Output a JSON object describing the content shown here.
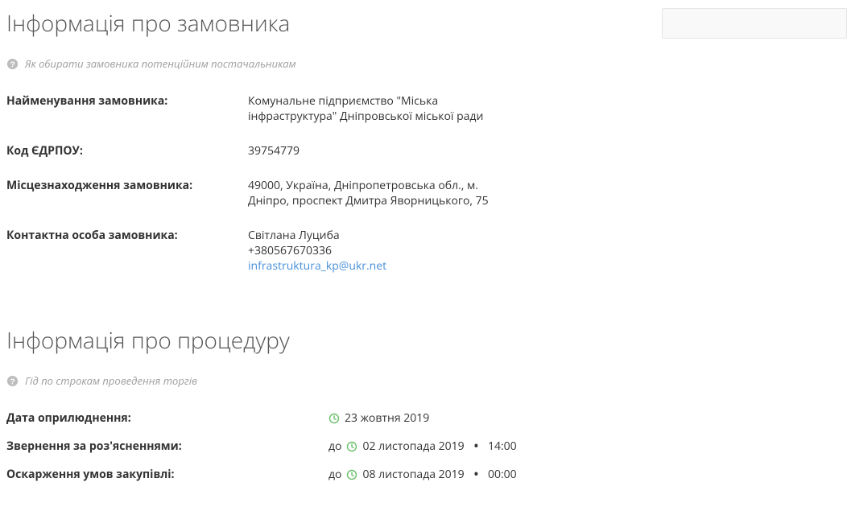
{
  "s1": {
    "title": "Інформація про замовника",
    "hint": "Як обирати замовника потенційним постачальникам",
    "rows": {
      "name_l": "Найменування замовника:",
      "name_v": "Комунальне підприємство \"Міська інфраструктура\" Дніпровської міської ради",
      "edrpou_l": "Код ЄДРПОУ:",
      "edrpou_v": "39754779",
      "loc_l": "Місцезнаходження замовника:",
      "loc_v": "49000, Україна, Дніпропетровська обл., м. Дніпро, проспект Дмитра Яворницького, 75",
      "contact_l": "Контактна особа замовника:",
      "contact_name": "Світлана Луциба",
      "contact_phone": "+380567670336",
      "contact_email": "infrastruktura_kp@ukr.net"
    }
  },
  "s2": {
    "title": "Інформація про процедуру",
    "hint": "Гід по строкам проведення торгів",
    "until": "до",
    "rows": {
      "pub_l": "Дата оприлюднення:",
      "pub_date": "23 жовтня 2019",
      "clar_l": "Звернення за роз'ясненнями:",
      "clar_date": "02 листопада 2019",
      "clar_time": "14:00",
      "appeal_l": "Оскарження умов закупівлі:",
      "appeal_date": "08 листопада 2019",
      "appeal_time": "00:00"
    }
  }
}
